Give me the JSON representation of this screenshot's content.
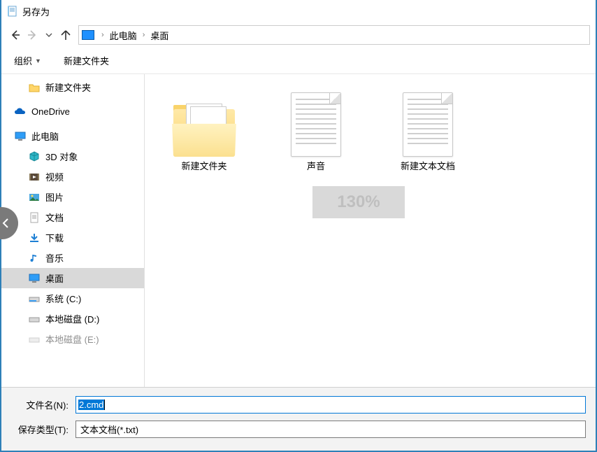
{
  "window": {
    "title": "另存为"
  },
  "nav": {
    "back_enabled": true,
    "forward_enabled": false
  },
  "breadcrumb": {
    "segments": [
      "此电脑",
      "桌面"
    ]
  },
  "toolbar": {
    "organize_label": "组织",
    "new_folder_label": "新建文件夹"
  },
  "sidebar": {
    "items": [
      {
        "label": "新建文件夹",
        "icon": "folder",
        "level": 1
      },
      {
        "label": "OneDrive",
        "icon": "onedrive",
        "level": 0
      },
      {
        "label": "此电脑",
        "icon": "pc",
        "level": 0
      },
      {
        "label": "3D 对象",
        "icon": "cube",
        "level": 1
      },
      {
        "label": "视频",
        "icon": "video",
        "level": 1
      },
      {
        "label": "图片",
        "icon": "picture",
        "level": 1
      },
      {
        "label": "文档",
        "icon": "document",
        "level": 1
      },
      {
        "label": "下载",
        "icon": "download",
        "level": 1
      },
      {
        "label": "音乐",
        "icon": "music",
        "level": 1
      },
      {
        "label": "桌面",
        "icon": "desktop",
        "level": 1,
        "selected": true
      },
      {
        "label": "系统 (C:)",
        "icon": "drive",
        "level": 1
      },
      {
        "label": "本地磁盘 (D:)",
        "icon": "drive",
        "level": 1
      },
      {
        "label": "本地磁盘 (E:)",
        "icon": "drive",
        "level": 1
      }
    ]
  },
  "items": [
    {
      "label": "新建文件夹",
      "type": "folder"
    },
    {
      "label": "声音",
      "type": "textfile"
    },
    {
      "label": "新建文本文档",
      "type": "textfile"
    }
  ],
  "zoom_overlay": "130%",
  "form": {
    "filename_label": "文件名(N):",
    "filename_value": "2.cmd",
    "filetype_label": "保存类型(T):",
    "filetype_value": "文本文档(*.txt)"
  },
  "icons": {
    "app": "notepad-icon",
    "back": "arrow-left-icon",
    "forward": "arrow-right-icon",
    "recent": "chevron-down-icon",
    "up": "arrow-up-icon"
  }
}
